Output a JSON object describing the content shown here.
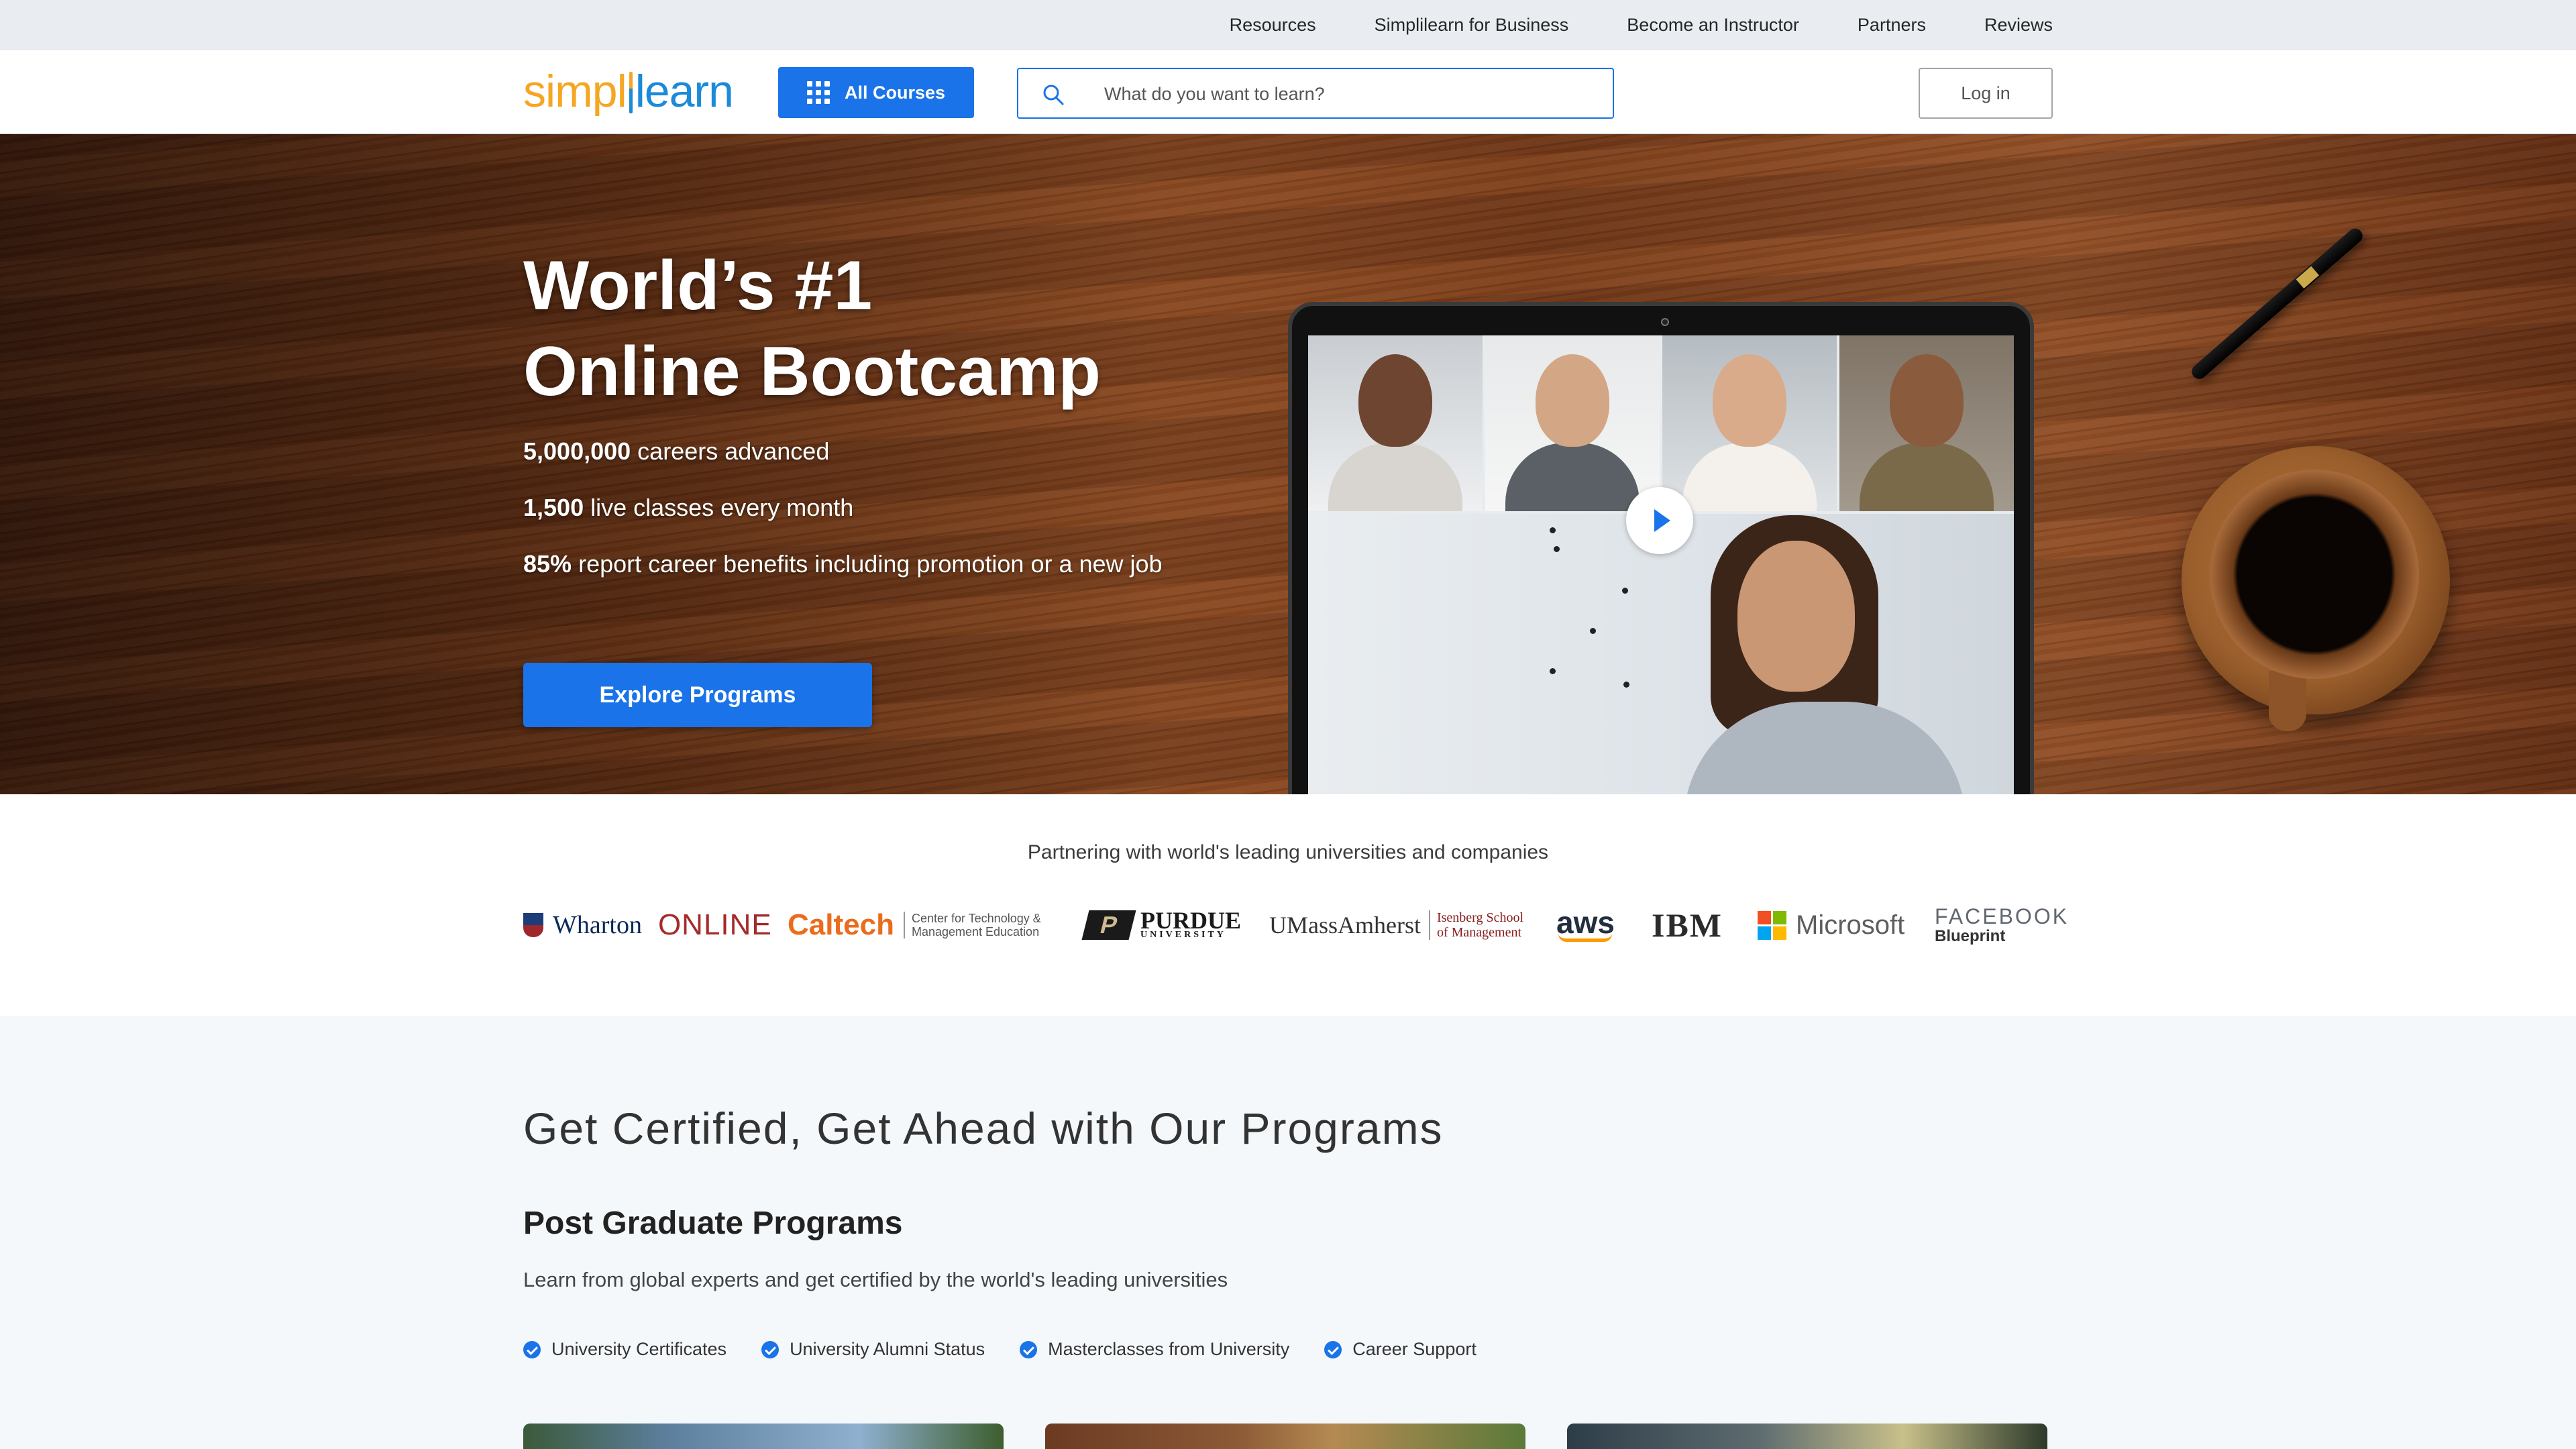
{
  "topbar": {
    "links": [
      "Resources",
      "Simplilearn for Business",
      "Become an Instructor",
      "Partners",
      "Reviews"
    ]
  },
  "header": {
    "logo_text_left": "simpl",
    "logo_text_right": "learn",
    "all_courses_label": "All Courses",
    "search_placeholder": "What do you want to learn?",
    "login_label": "Log in"
  },
  "hero": {
    "title_line1": "World’s #1",
    "title_line2": "Online Bootcamp",
    "stats": [
      {
        "value": "5,000,000",
        "text": "careers advanced"
      },
      {
        "value": "1,500",
        "text": "live classes every month"
      },
      {
        "value": "85%",
        "text": "report career benefits including promotion or a new job"
      }
    ],
    "cta_label": "Explore Programs"
  },
  "partners": {
    "heading": "Partnering with world's leading universities and companies",
    "logos": {
      "wharton": "Wharton",
      "wharton_online": "ONLINE",
      "caltech": "Caltech",
      "caltech_ctme_1": "Center for Technology &",
      "caltech_ctme_2": "Management Education",
      "purdue": "PURDUE",
      "purdue_sub": "UNIVERSITY",
      "umass": "UMassAmherst",
      "umass_sub_1": "Isenberg School",
      "umass_sub_2": "of Management",
      "aws": "aws",
      "ibm": "IBM",
      "microsoft": "Microsoft",
      "facebook": "FACEBOOK",
      "facebook_sub": "Blueprint"
    }
  },
  "programs": {
    "section_title": "Get Certified, Get Ahead with Our Programs",
    "category_title": "Post Graduate Programs",
    "category_desc": "Learn from global experts and get certified by the world's leading universities",
    "features": [
      "University Certificates",
      "University Alumni Status",
      "Masterclasses from University",
      "Career Support"
    ]
  },
  "colors": {
    "brand_blue": "#1a73e8",
    "logo_orange": "#f5a623",
    "logo_blue": "#1b8ad9",
    "topbar_bg": "#e9edf1"
  },
  "icons": [
    "grid-icon",
    "search-icon",
    "play-icon",
    "check-badge-icon"
  ]
}
